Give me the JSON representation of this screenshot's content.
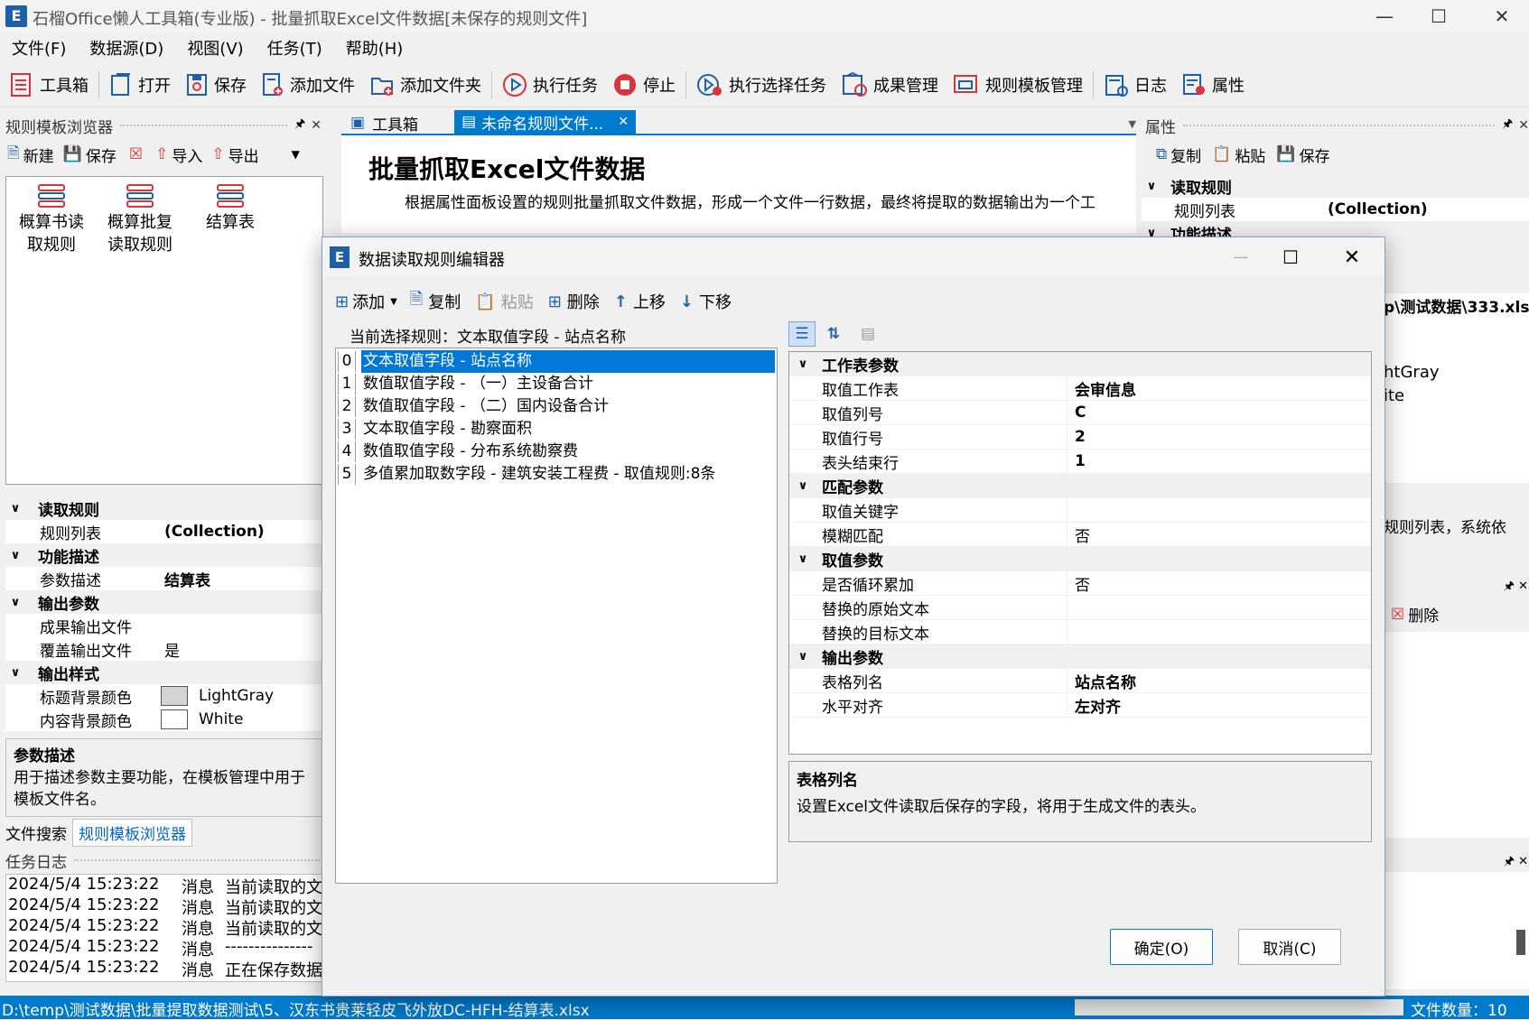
{
  "window": {
    "app_icon_letter": "E",
    "title": "石榴Office懒人工具箱(专业版) - 批量抓取Excel文件数据[未保存的规则文件]"
  },
  "menu": [
    "文件(F)",
    "数据源(D)",
    "视图(V)",
    "任务(T)",
    "帮助(H)"
  ],
  "toolbar": {
    "toolbox": "工具箱",
    "open": "打开",
    "save": "保存",
    "add_file": "添加文件",
    "add_folder": "添加文件夹",
    "run": "执行任务",
    "stop": "停止",
    "run_selected": "执行选择任务",
    "results": "成果管理",
    "templates": "规则模板管理",
    "log": "日志",
    "properties": "属性"
  },
  "left_panel": {
    "title": "规则模板浏览器",
    "actions": {
      "new": "新建",
      "save": "保存",
      "import": "导入",
      "export": "导出"
    },
    "templates": [
      {
        "label": "概算书读取规则"
      },
      {
        "label": "概算批复读取规则"
      },
      {
        "label": "结算表"
      }
    ],
    "props": {
      "cat_read": "读取规则",
      "rule_list": "规则列表",
      "rule_list_val": "(Collection)",
      "cat_func": "功能描述",
      "param_desc": "参数描述",
      "param_desc_val": "结算表",
      "cat_output": "输出参数",
      "out_file": "成果输出文件",
      "overwrite": "覆盖输出文件",
      "overwrite_val": "是",
      "cat_style": "输出样式",
      "title_bg": "标题背景颜色",
      "title_bg_val": "LightGray",
      "content_bg": "内容背景颜色",
      "content_bg_val": "White"
    },
    "desc_title": "参数描述",
    "desc_text": "用于描述参数主要功能，在模板管理中用于模板文件名。",
    "tabs": [
      "文件搜索",
      "规则模板浏览器"
    ]
  },
  "log_panel": {
    "title": "任务日志",
    "rows": [
      {
        "time": "2024/5/4 15:23:22",
        "type": "消息",
        "msg": "当前读取的文"
      },
      {
        "time": "2024/5/4 15:23:22",
        "type": "消息",
        "msg": "当前读取的文"
      },
      {
        "time": "2024/5/4 15:23:22",
        "type": "消息",
        "msg": "当前读取的文"
      },
      {
        "time": "2024/5/4 15:23:22",
        "type": "消息",
        "msg": "---------------"
      },
      {
        "time": "2024/5/4 15:23:22",
        "type": "消息",
        "msg": "正在保存数据"
      }
    ]
  },
  "doc_tabs": [
    "工具箱",
    "未命名规则文件..."
  ],
  "doc": {
    "heading": "批量抓取Excel文件数据",
    "subtext": "根据属性面板设置的规则批量抓取文件数据，形成一个文件一行数据，最终将提取的数据输出为一个工"
  },
  "right_panel": {
    "title": "属性",
    "actions": {
      "copy": "复制",
      "paste": "粘贴",
      "save": "保存"
    },
    "cat_read": "读取规则",
    "rule_list": "规则列表",
    "rule_list_val": "(Collection)",
    "cat_func": "功能描述",
    "partial1": "p\\测试数据\\333.xls",
    "partial2": "htGray",
    "partial3": "ite",
    "partial4": "规则列表，系统依",
    "delete": "删除"
  },
  "dialog": {
    "title": "数据读取规则编辑器",
    "toolbar": {
      "add": "添加",
      "copy": "复制",
      "paste": "粘贴",
      "delete": "删除",
      "up": "上移",
      "down": "下移"
    },
    "current_label": "当前选择规则：文本取值字段 - 站点名称",
    "rules": [
      {
        "idx": "0",
        "text": "文本取值字段 - 站点名称"
      },
      {
        "idx": "1",
        "text": "数值取值字段 - （一）主设备合计"
      },
      {
        "idx": "2",
        "text": "数值取值字段 - （二）国内设备合计"
      },
      {
        "idx": "3",
        "text": "文本取值字段 - 勘察面积"
      },
      {
        "idx": "4",
        "text": "数值取值字段 - 分布系统勘察费"
      },
      {
        "idx": "5",
        "text": "多值累加取数字段 - 建筑安装工程费 - 取值规则:8条"
      }
    ],
    "props": [
      {
        "cat": "工作表参数",
        "rows": [
          {
            "name": "取值工作表",
            "val": "会审信息",
            "bold": true
          },
          {
            "name": "取值列号",
            "val": "C",
            "bold": true
          },
          {
            "name": "取值行号",
            "val": "2",
            "bold": true
          },
          {
            "name": "表头结束行",
            "val": "1",
            "bold": true
          }
        ]
      },
      {
        "cat": "匹配参数",
        "rows": [
          {
            "name": "取值关键字",
            "val": "",
            "bold": false
          },
          {
            "name": "模糊匹配",
            "val": "否",
            "bold": false
          }
        ]
      },
      {
        "cat": "取值参数",
        "rows": [
          {
            "name": "是否循环累加",
            "val": "否",
            "bold": false
          },
          {
            "name": "替换的原始文本",
            "val": "",
            "bold": false
          },
          {
            "name": "替换的目标文本",
            "val": "",
            "bold": false
          }
        ]
      },
      {
        "cat": "输出参数",
        "rows": [
          {
            "name": "表格列名",
            "val": "站点名称",
            "bold": true
          },
          {
            "name": "水平对齐",
            "val": "左对齐",
            "bold": true
          }
        ]
      }
    ],
    "desc_title": "表格列名",
    "desc_text": "设置Excel文件读取后保存的字段，将用于生成文件的表头。",
    "ok": "确定(O)",
    "cancel": "取消(C)"
  },
  "status": {
    "path": "D:\\temp\\测试数据\\批量提取数据测试\\5、汉东书贵莱轻皮飞外放DC-HFH-结算表.xlsx",
    "count": "文件数量：10"
  },
  "colors": {
    "accent": "#0078d7",
    "status_bar": "#007acc",
    "icon_blue": "#1f5fa8",
    "icon_red": "#d9343a"
  }
}
